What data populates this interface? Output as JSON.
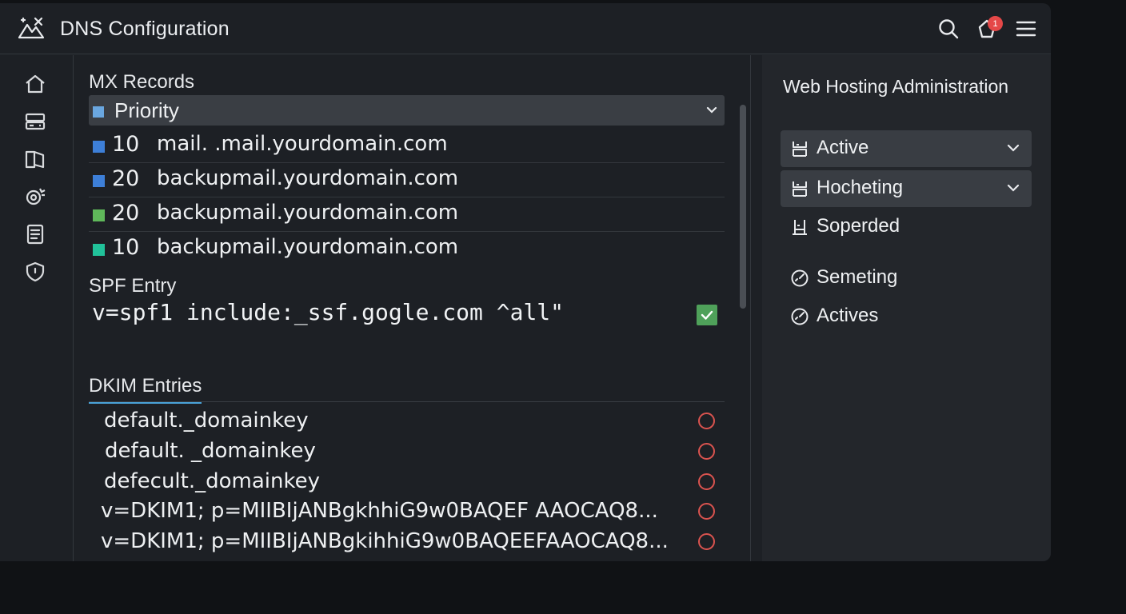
{
  "header": {
    "title": "DNS Configuration",
    "notification_count": "1"
  },
  "sidebar": {
    "items": [
      {
        "icon": "home-icon"
      },
      {
        "icon": "server-icon"
      },
      {
        "icon": "book-icon"
      },
      {
        "icon": "settings-icon"
      },
      {
        "icon": "document-icon"
      },
      {
        "icon": "shield-icon"
      }
    ]
  },
  "mx": {
    "title": "MX Records",
    "header_label": "Priority",
    "header_color": "#6aa7e0",
    "rows": [
      {
        "priority": "10",
        "host": "mail. .mail.yourdomain.com",
        "color": "#3d7fd8"
      },
      {
        "priority": "20",
        "host": "backupmail.yourdomain.com",
        "color": "#3d7fd8"
      },
      {
        "priority": "20",
        "host": "backupmail.yourdomain.com",
        "color": "#5fb85a"
      },
      {
        "priority": "10",
        "host": "backupmail.yourdomain.com",
        "color": "#21c29a"
      }
    ]
  },
  "spf": {
    "title": "SPF Entry",
    "value": "v=spf1 include:_ssf.gogle.com ^all\"",
    "checked": true
  },
  "dkim": {
    "title": "DKIM Entries",
    "rows": [
      {
        "text": "default._domainkey"
      },
      {
        "text": "default. _domainkey"
      },
      {
        "text": "defecult._domainkey"
      },
      {
        "text": "v=DKIM1; p=MIIBIjANBgkhhiG9w0BAQEF AAOCAQ8..."
      },
      {
        "text": "v=DKIM1; p=MIIBIjANBgkihhiG9w0BAQEEFAAOCAQ8..."
      }
    ]
  },
  "panel": {
    "title": "Web Hosting Administration",
    "items": [
      {
        "label": "Active",
        "icon": "server-stack-icon",
        "dropdown": true
      },
      {
        "label": "Hocheting",
        "icon": "server-stack-icon",
        "dropdown": true
      },
      {
        "label": "Soperded",
        "icon": "server-stand-icon",
        "dropdown": false
      },
      {
        "label": "Semeting",
        "icon": "gauge-icon",
        "dropdown": false
      },
      {
        "label": "Actives",
        "icon": "gauge-icon",
        "dropdown": false
      }
    ]
  }
}
